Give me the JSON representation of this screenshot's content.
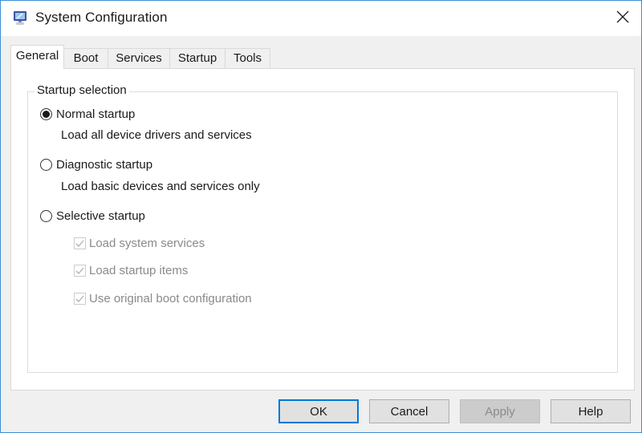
{
  "window": {
    "title": "System Configuration",
    "icon": "msconfig-monitor-icon",
    "close_icon": "close-icon",
    "accent_border_color": "#3f8fd4"
  },
  "tabs": [
    {
      "label": "General",
      "active": true
    },
    {
      "label": "Boot",
      "active": false
    },
    {
      "label": "Services",
      "active": false
    },
    {
      "label": "Startup",
      "active": false
    },
    {
      "label": "Tools",
      "active": false
    }
  ],
  "general": {
    "group_title": "Startup selection",
    "options": [
      {
        "label": "Normal startup",
        "description": "Load all device drivers and services",
        "selected": true
      },
      {
        "label": "Diagnostic startup",
        "description": "Load basic devices and services only",
        "selected": false
      },
      {
        "label": "Selective startup",
        "selected": false
      }
    ],
    "selective_items": [
      {
        "label": "Load system services",
        "checked": true,
        "enabled": false
      },
      {
        "label": "Load startup items",
        "checked": true,
        "enabled": false
      },
      {
        "label": "Use original boot configuration",
        "checked": true,
        "enabled": false
      }
    ]
  },
  "buttons": {
    "ok": "OK",
    "cancel": "Cancel",
    "apply": "Apply",
    "help": "Help"
  }
}
